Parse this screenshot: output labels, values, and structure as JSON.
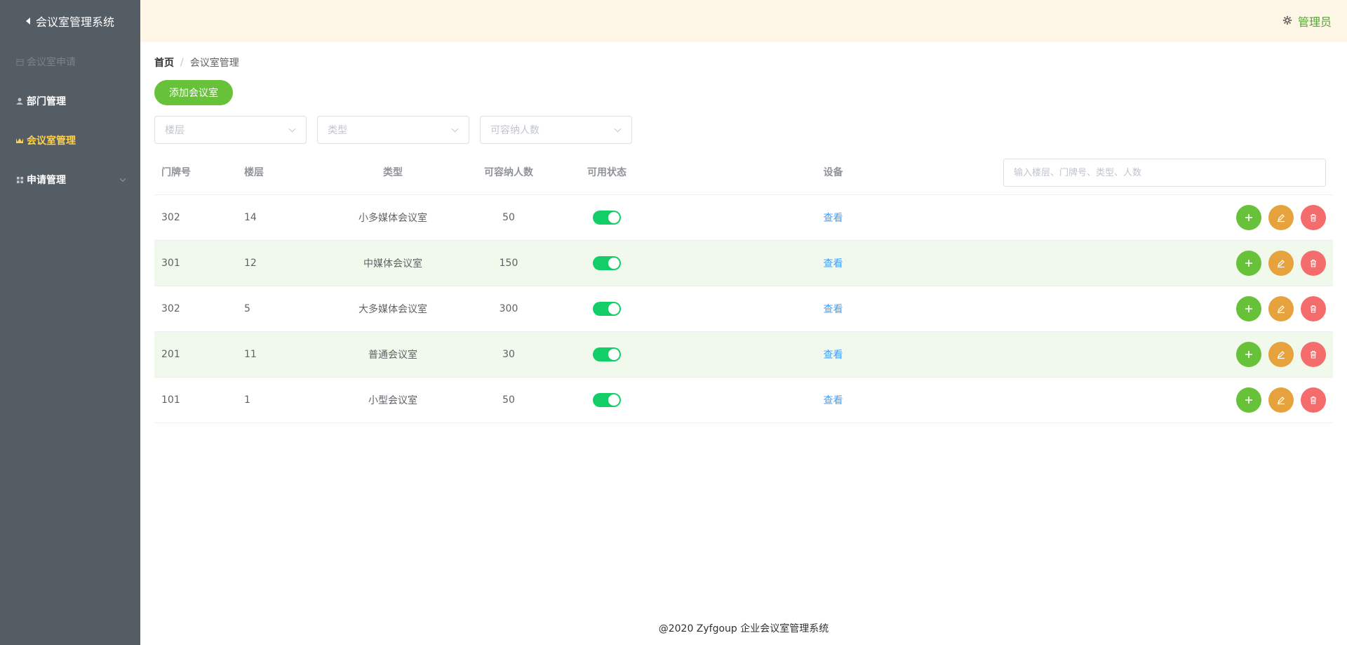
{
  "sidebar": {
    "title": "会议室管理系统",
    "items": [
      {
        "label": "会议室申请",
        "icon": "calendar-icon"
      },
      {
        "label": "部门管理",
        "icon": "user-icon"
      },
      {
        "label": "会议室管理",
        "icon": "crown-icon"
      },
      {
        "label": "申请管理",
        "icon": "grid-icon"
      }
    ]
  },
  "header": {
    "admin_label": "管理员",
    "icon": "gear-icon"
  },
  "breadcrumb": {
    "home": "首页",
    "separator": "/",
    "current": "会议室管理"
  },
  "toolbar": {
    "add_label": "添加会议室"
  },
  "filters": {
    "floor_placeholder": "楼层",
    "type_placeholder": "类型",
    "capacity_placeholder": "可容纳人数"
  },
  "table": {
    "columns": [
      "门牌号",
      "楼层",
      "类型",
      "可容纳人数",
      "可用状态",
      "设备"
    ],
    "search_placeholder": "输入楼层、门牌号、类型、人数",
    "view_label": "查看",
    "rows": [
      {
        "door": "302",
        "floor": "14",
        "type": "小多媒体会议室",
        "capacity": "50",
        "enabled": true
      },
      {
        "door": "301",
        "floor": "12",
        "type": "中媒体会议室",
        "capacity": "150",
        "enabled": true
      },
      {
        "door": "302",
        "floor": "5",
        "type": "大多媒体会议室",
        "capacity": "300",
        "enabled": true
      },
      {
        "door": "201",
        "floor": "11",
        "type": "普通会议室",
        "capacity": "30",
        "enabled": true
      },
      {
        "door": "101",
        "floor": "1",
        "type": "小型会议室",
        "capacity": "50",
        "enabled": true
      }
    ]
  },
  "footer": {
    "text": "@2020 Zyfgoup 企业会议室管理系统"
  },
  "colors": {
    "sidebar": "#545c64",
    "active": "#ffd04b",
    "header": "#fdf5e6",
    "primary": "#67c23a",
    "warning": "#e6a23c",
    "danger": "#f56c6c",
    "switch_on": "#13ce66",
    "stripe": "#f0f9eb"
  }
}
